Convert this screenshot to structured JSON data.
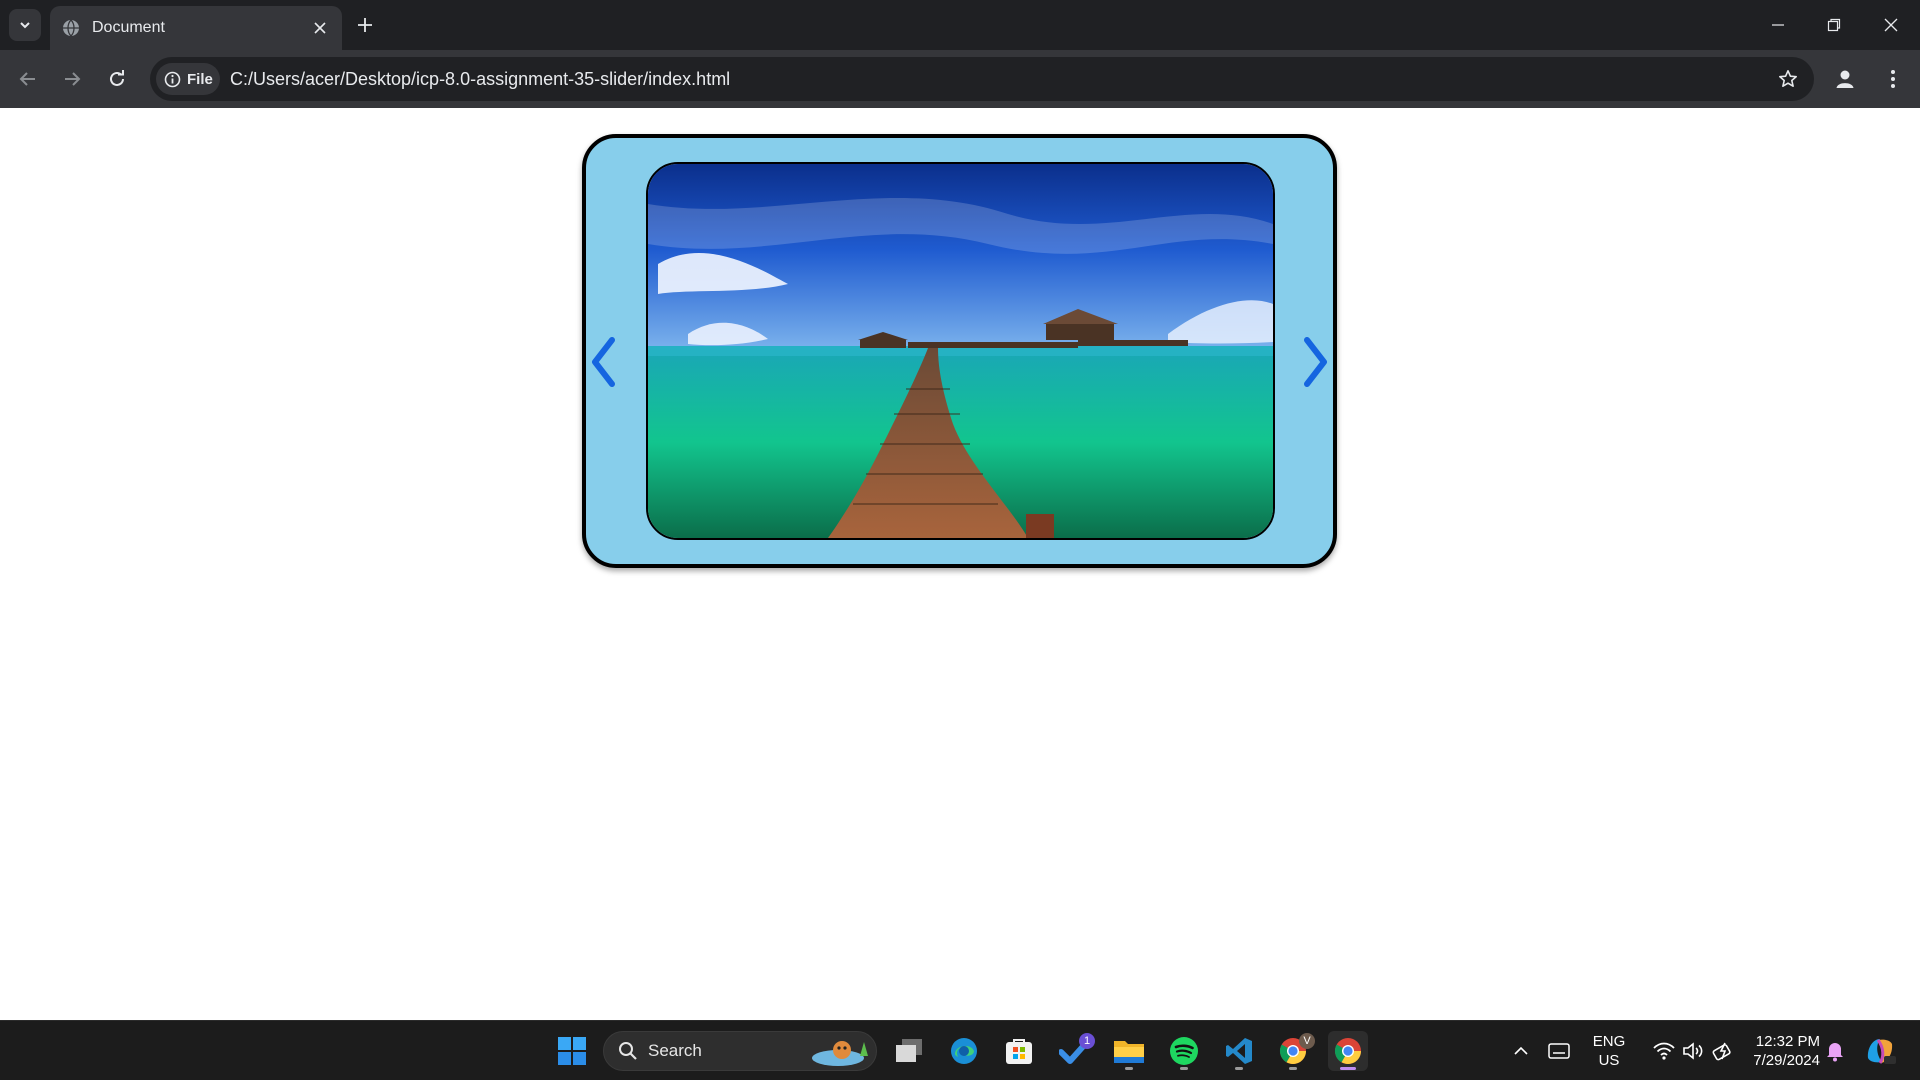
{
  "browser": {
    "tab_title": "Document",
    "address_chip_label": "File",
    "url": "C:/Users/acer/Desktop/icp-8.0-assignment-35-slider/index.html"
  },
  "slider": {
    "background_color": "#87ceeb",
    "arrow_color": "#1565e0",
    "image_description_icon": "overwater-bungalow-boardwalk-photo",
    "prev_icon": "chevron-left-icon",
    "next_icon": "chevron-right-icon"
  },
  "taskbar": {
    "search_placeholder": "Search",
    "todo_badge": "1",
    "chrome_profile_badge": "V",
    "language_line1": "ENG",
    "language_line2": "US",
    "time": "12:32 PM",
    "date": "7/29/2024"
  }
}
